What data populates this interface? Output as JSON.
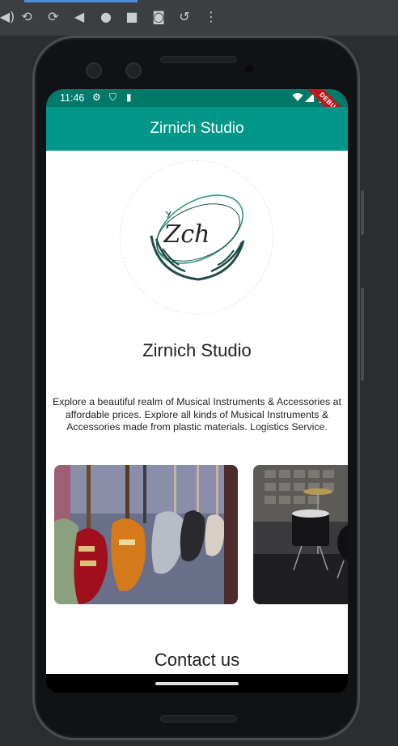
{
  "emulator": {
    "toolbar_icons": [
      "volume-icon",
      "rotate-left-icon",
      "rotate-right-icon",
      "back-icon",
      "home-icon",
      "overview-icon",
      "camera-icon",
      "replay-icon",
      "more-icon"
    ]
  },
  "status_bar": {
    "time": "11:46",
    "left_icons": [
      "gear-icon",
      "shield-icon",
      "sd-card-icon"
    ],
    "right_icons": [
      "wifi-icon",
      "signal-icon",
      "battery-icon"
    ],
    "debug_banner": "DEBUG"
  },
  "app_bar": {
    "title": "Zirnich Studio",
    "color": "#009688"
  },
  "main": {
    "logo_text": "Zch",
    "studio_name": "Zirnich Studio",
    "description": "Explore a beautiful realm of Musical Instruments & Accessories at affordable prices. Explore all kinds of Musical Instruments & Accessories made from plastic materials. Logistics Service.",
    "gallery": [
      {
        "name": "guitars-image",
        "subject": "guitars"
      },
      {
        "name": "drums-image",
        "subject": "drum kit"
      }
    ],
    "contact_heading": "Contact us"
  },
  "colors": {
    "status_bar": "#00796b",
    "accent": "#009688",
    "logo_dark": "#1f4d45",
    "logo_light": "#2e9c83"
  }
}
